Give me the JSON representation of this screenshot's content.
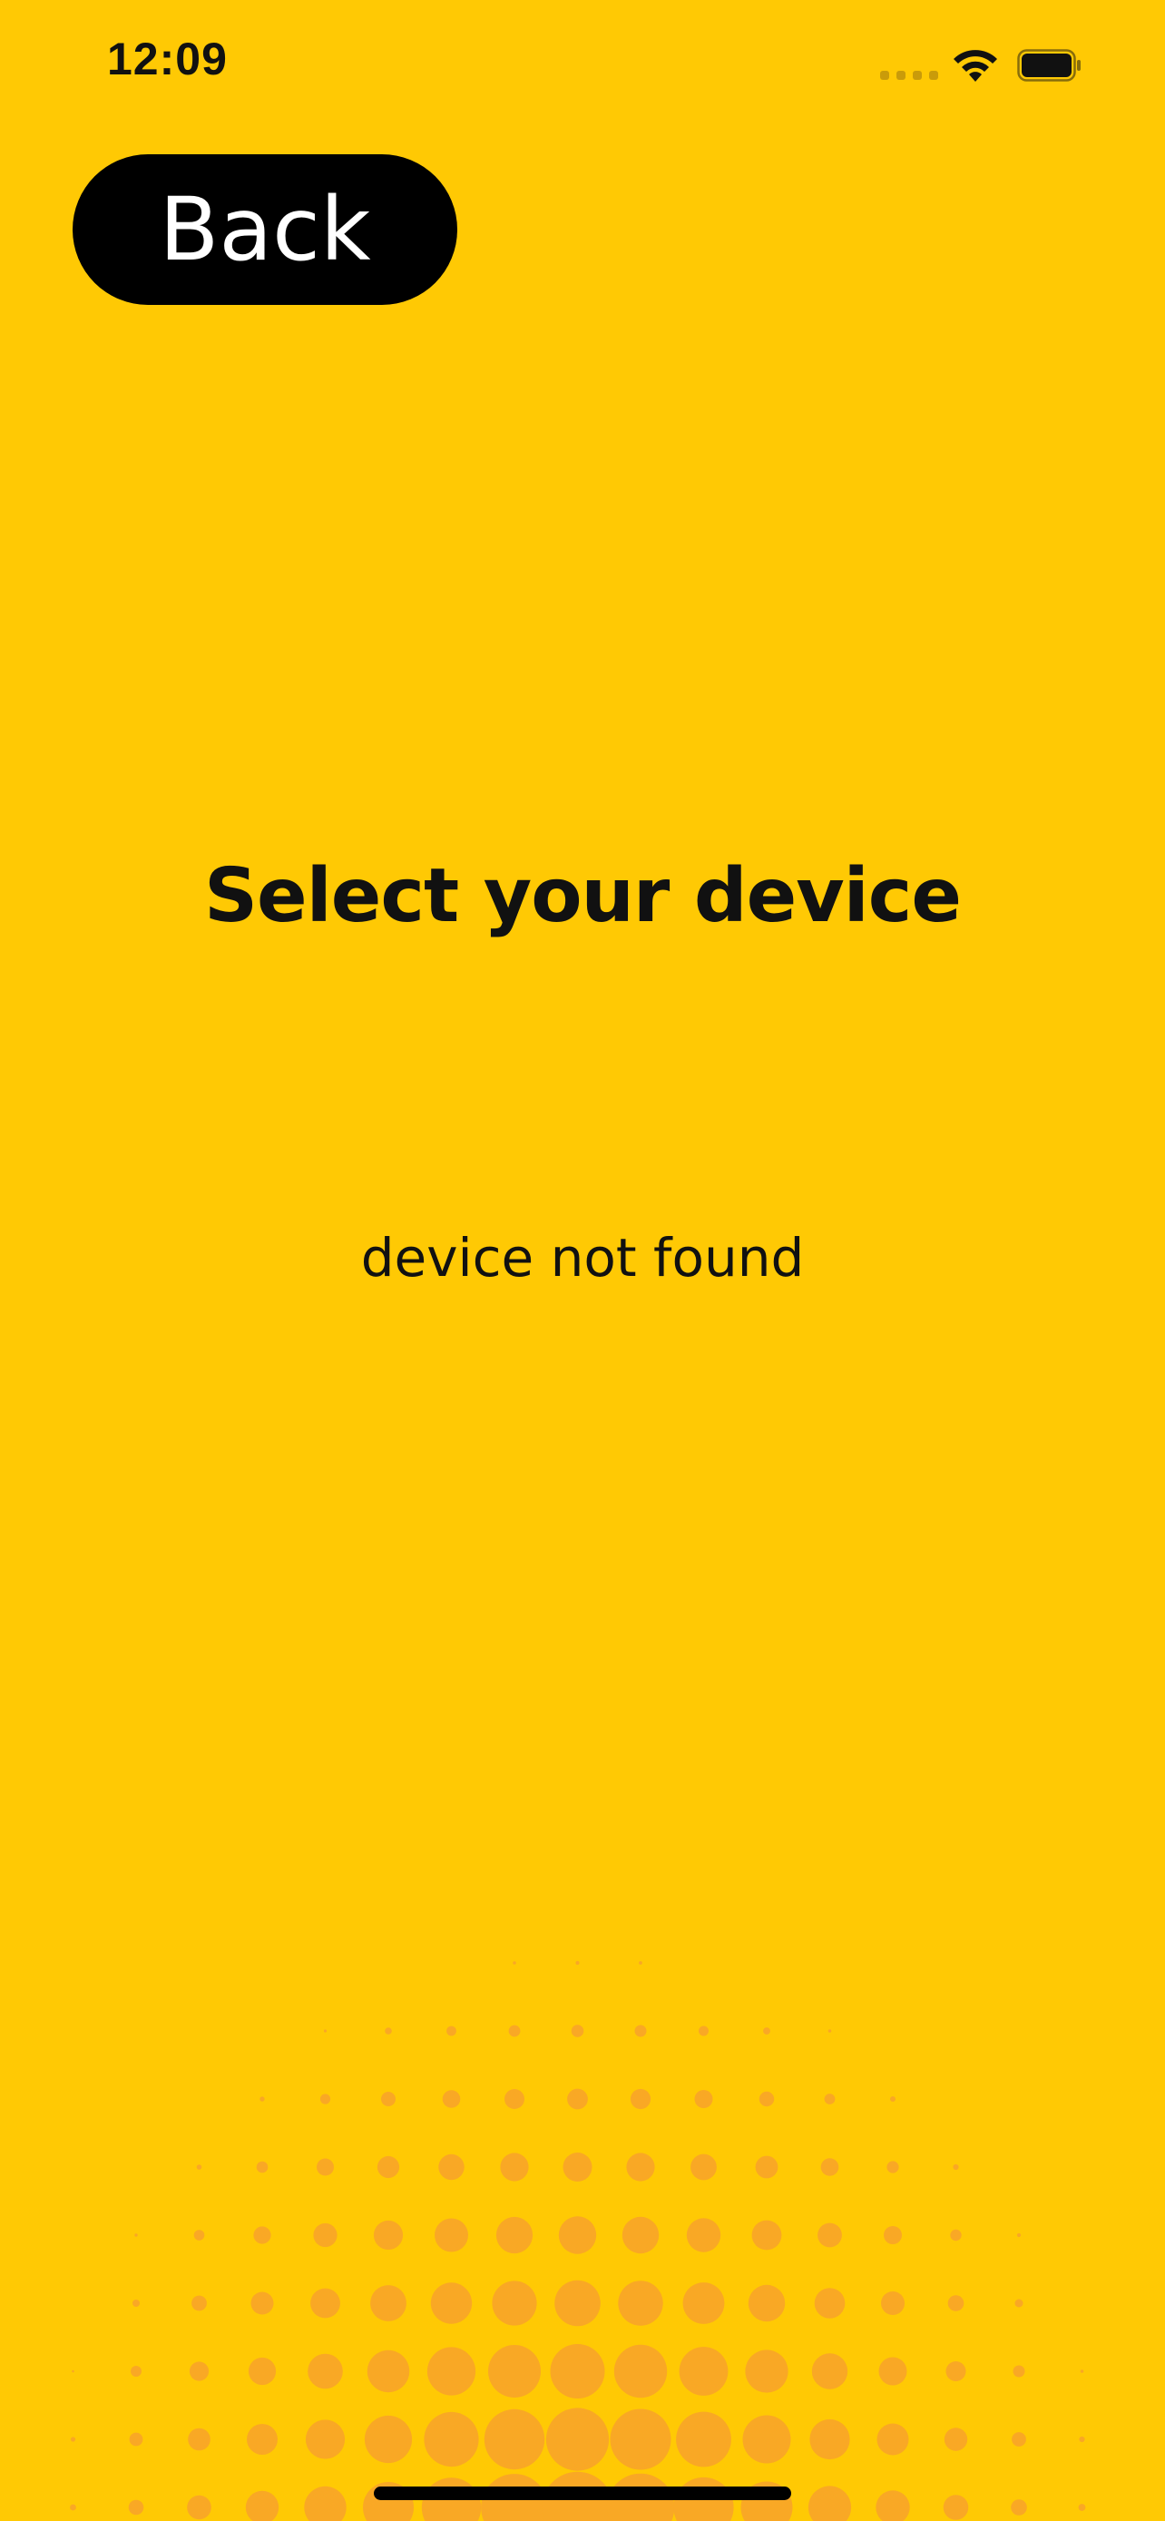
{
  "status_bar": {
    "time": "12:09"
  },
  "nav": {
    "back_label": "Back"
  },
  "main": {
    "title": "Select your device",
    "status_message": "device not found"
  },
  "colors": {
    "background": "#FFC904",
    "halftone_dot": "#F9A825",
    "button_bg": "#000000",
    "button_text": "#FFFFFF"
  },
  "decoration": {
    "pattern": "halftone-dots"
  }
}
